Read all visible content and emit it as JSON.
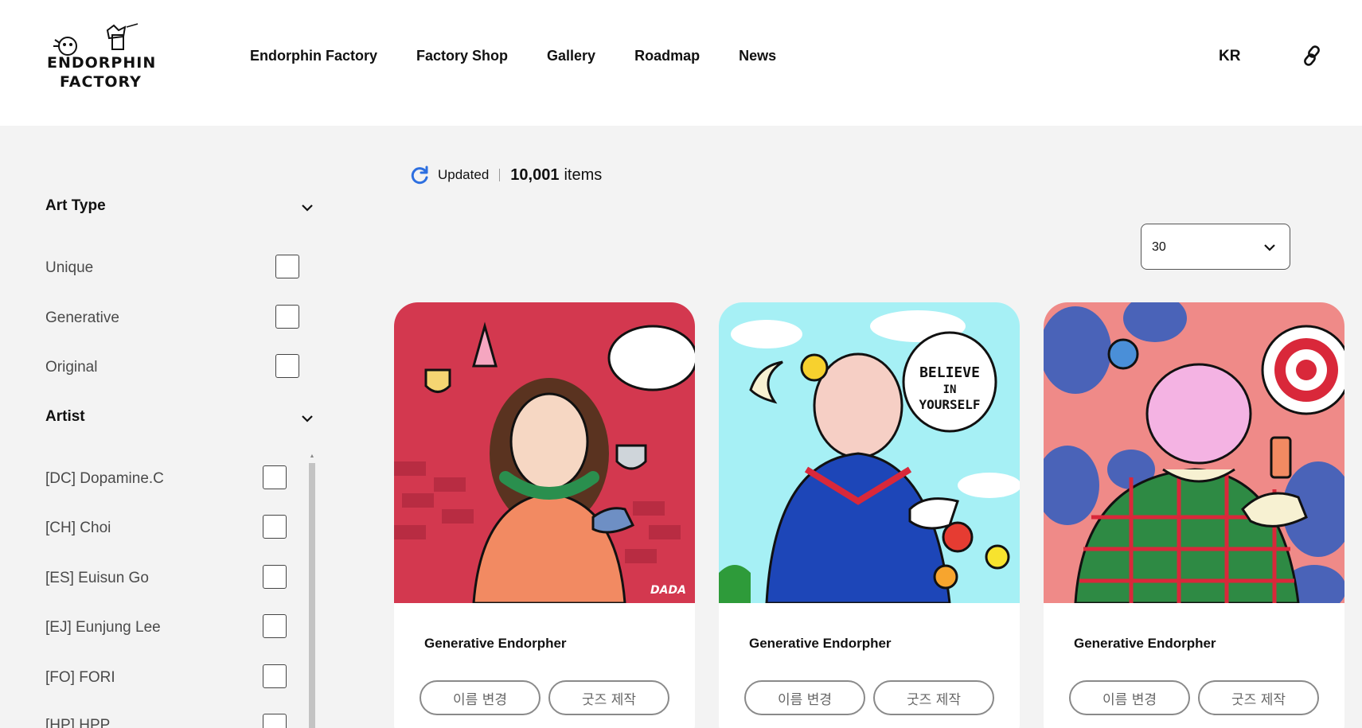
{
  "header": {
    "logo": {
      "line1": "ENDORPHIN",
      "line2": "FACTORY"
    },
    "nav": [
      "Endorphin Factory",
      "Factory Shop",
      "Gallery",
      "Roadmap",
      "News"
    ],
    "lang": "KR",
    "link_icon": "link-icon"
  },
  "sidebar": {
    "art_type": {
      "title": "Art Type",
      "options": [
        "Unique",
        "Generative",
        "Original"
      ]
    },
    "artist": {
      "title": "Artist",
      "options": [
        "[DC] Dopamine.C",
        "[CH] Choi",
        "[ES] Euisun Go",
        "[EJ] Eunjung Lee",
        "[FO] FORI",
        "[HP] HPP"
      ]
    }
  },
  "main": {
    "status": {
      "updated": "Updated",
      "count": "10,001",
      "items": "items"
    },
    "page_size": "30",
    "cards": [
      {
        "title": "Generative Endorpher",
        "rename": "이름 변경",
        "goods": "굿즈 제작",
        "colors": {
          "bg": "#d3384f",
          "accent": "#f08a5d"
        }
      },
      {
        "title": "Generative Endorpher",
        "rename": "이름 변경",
        "goods": "굿즈 제작",
        "colors": {
          "bg": "#a6f0f5",
          "accent": "#1d46b8"
        }
      },
      {
        "title": "Generative Endorpher",
        "rename": "이름 변경",
        "goods": "굿즈 제작",
        "colors": {
          "bg": "#ef8a88",
          "accent": "#4a63b8"
        }
      }
    ],
    "card_art": {
      "speech_bubble": {
        "line1": "BELIEVE",
        "line2": "IN",
        "line3": "YOURSELF"
      },
      "signature": "DADA"
    }
  },
  "colors": {
    "page_bg": "#f3f3f3",
    "header_bg": "#ffffff",
    "refresh": "#2d6fe0"
  }
}
